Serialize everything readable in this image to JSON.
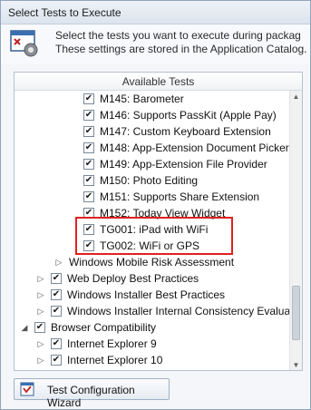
{
  "window": {
    "title": "Select Tests to Execute"
  },
  "header": {
    "line1": "Select the tests you want to execute during packag",
    "line2": "These settings are stored in the Application Catalog."
  },
  "panel": {
    "column_header": "Available Tests"
  },
  "tree": [
    {
      "label": "M145: Barometer",
      "checked": true
    },
    {
      "label": "M146: Supports PassKit (Apple Pay)",
      "checked": true
    },
    {
      "label": "M147: Custom Keyboard Extension",
      "checked": true
    },
    {
      "label": "M148: App-Extension Document Picker",
      "checked": true
    },
    {
      "label": "M149: App-Extension File Provider",
      "checked": true
    },
    {
      "label": "M150: Photo Editing",
      "checked": true
    },
    {
      "label": "M151: Supports Share Extension",
      "checked": true
    },
    {
      "label": "M152: Today View Widget",
      "checked": true
    },
    {
      "label": "TG001: iPad with WiFi",
      "checked": true
    },
    {
      "label": "TG002: WiFi or GPS",
      "checked": true
    },
    {
      "label": "Windows Mobile Risk Assessment",
      "checked": false
    },
    {
      "label": "Web Deploy Best Practices",
      "checked": true
    },
    {
      "label": "Windows Installer Best Practices",
      "checked": true
    },
    {
      "label": "Windows Installer Internal Consistency Evalua...",
      "checked": true
    },
    {
      "label": "Browser Compatibility",
      "checked": true
    },
    {
      "label": "Internet Explorer 9",
      "checked": true
    },
    {
      "label": "Internet Explorer 10",
      "checked": true
    }
  ],
  "footer": {
    "button_label": "Test Configuration Wizard"
  },
  "icons": {
    "header": "settings-document-icon",
    "wizard": "checklist-icon",
    "expand": "chevron-right-icon",
    "collapse": "chevron-down-icon"
  },
  "colors": {
    "highlight": "#e02020"
  }
}
